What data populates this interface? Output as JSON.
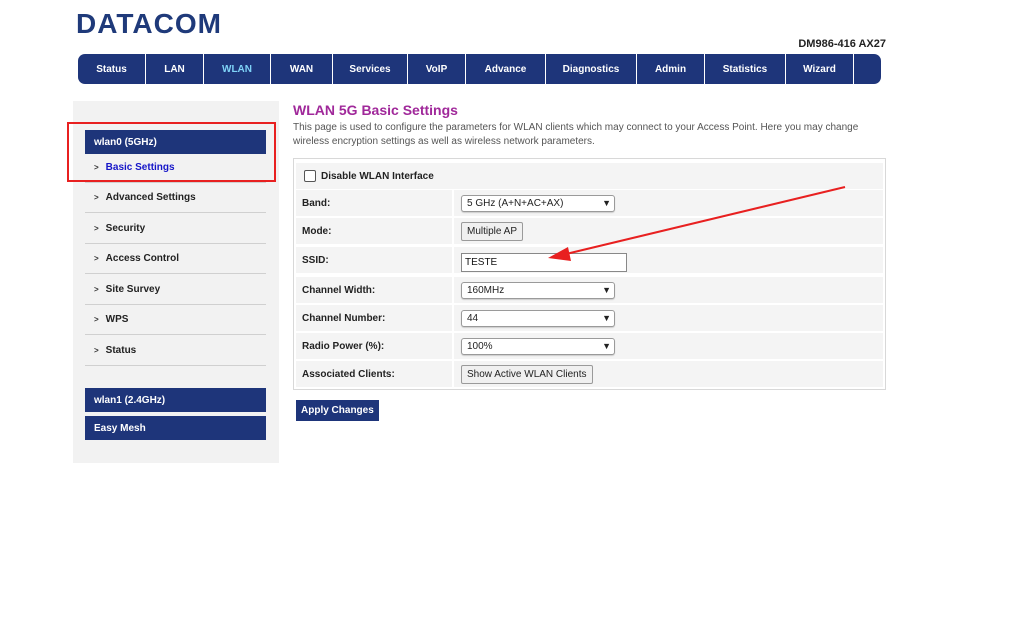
{
  "header": {
    "logo": "DATACOM",
    "model": "DM986-416 AX27"
  },
  "nav": {
    "tabs": [
      {
        "label": "Status",
        "w": 68
      },
      {
        "label": "LAN",
        "w": 58
      },
      {
        "label": "WLAN",
        "w": 67
      },
      {
        "label": "WAN",
        "w": 62
      },
      {
        "label": "Services",
        "w": 75
      },
      {
        "label": "VoIP",
        "w": 58
      },
      {
        "label": "Advance",
        "w": 80
      },
      {
        "label": "Diagnostics",
        "w": 91
      },
      {
        "label": "Admin",
        "w": 68
      },
      {
        "label": "Statistics",
        "w": 81
      },
      {
        "label": "Wizard",
        "w": 68
      }
    ],
    "active": "WLAN"
  },
  "sidebar": {
    "group1": "wlan0 (5GHz)",
    "items": [
      "Basic Settings",
      "Advanced Settings",
      "Security",
      "Access Control",
      "Site Survey",
      "WPS",
      "Status"
    ],
    "active_item": "Basic Settings",
    "group2": "wlan1 (2.4GHz)",
    "group3": "Easy Mesh"
  },
  "main": {
    "title": "WLAN 5G Basic Settings",
    "description": "This page is used to configure the parameters for WLAN clients which may connect to your Access Point. Here you may change wireless encryption settings as well as wireless network parameters.",
    "disable_label": "Disable WLAN Interface",
    "disable_checked": false,
    "band_label": "Band:",
    "band_value": "5 GHz (A+N+AC+AX)",
    "mode_label": "Mode:",
    "mode_button": "Multiple AP",
    "ssid_label": "SSID:",
    "ssid_value": "TESTE",
    "chwidth_label": "Channel Width:",
    "chwidth_value": "160MHz",
    "chnum_label": "Channel Number:",
    "chnum_value": "44",
    "power_label": "Radio Power (%):",
    "power_value": "100%",
    "clients_label": "Associated Clients:",
    "clients_button": "Show Active WLAN Clients",
    "apply_button": "Apply Changes"
  },
  "annotation": {
    "arrow_color": "#e82020",
    "box_color": "#e82020"
  }
}
